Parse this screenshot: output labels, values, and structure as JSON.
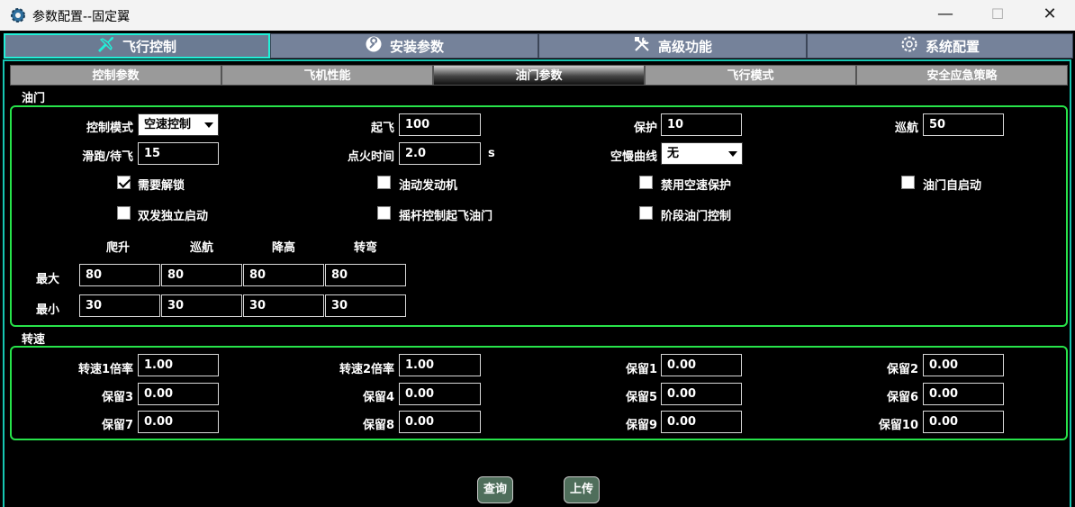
{
  "window": {
    "title": "参数配置--固定翼",
    "minimize": "—",
    "maximize": "☐",
    "close": "✕"
  },
  "main_tabs": [
    {
      "label": "飞行控制",
      "icon": "airplane-icon",
      "active": true
    },
    {
      "label": "安装参数",
      "icon": "wrench-circle-icon",
      "active": false
    },
    {
      "label": "高级功能",
      "icon": "tools-icon",
      "active": false
    },
    {
      "label": "系统配置",
      "icon": "gear-icon",
      "active": false
    }
  ],
  "sub_tabs": [
    {
      "label": "控制参数",
      "active": false
    },
    {
      "label": "飞机性能",
      "active": false
    },
    {
      "label": "油门参数",
      "active": true
    },
    {
      "label": "飞行模式",
      "active": false
    },
    {
      "label": "安全应急策略",
      "active": false
    }
  ],
  "throttle": {
    "section_title": "油门",
    "control_mode": {
      "label": "控制模式",
      "value": "空速控制"
    },
    "takeoff": {
      "label": "起飞",
      "value": "100"
    },
    "protect": {
      "label": "保护",
      "value": "10"
    },
    "cruise": {
      "label": "巡航",
      "value": "50"
    },
    "taxi_standby": {
      "label": "滑跑/待飞",
      "value": "15"
    },
    "ignition_time": {
      "label": "点火时间",
      "value": "2.0",
      "unit": "s"
    },
    "idle_curve": {
      "label": "空慢曲线",
      "value": "无"
    },
    "checkboxes": [
      {
        "label": "需要解锁",
        "checked": true
      },
      {
        "label": "油动发动机",
        "checked": false
      },
      {
        "label": "禁用空速保护",
        "checked": false
      },
      {
        "label": "油门自启动",
        "checked": false
      },
      {
        "label": "双发独立启动",
        "checked": false
      },
      {
        "label": "摇杆控制起飞油门",
        "checked": false
      },
      {
        "label": "阶段油门控制",
        "checked": false
      }
    ],
    "limits": {
      "columns": [
        "爬升",
        "巡航",
        "降高",
        "转弯"
      ],
      "rows": [
        {
          "label": "最大",
          "values": [
            "80",
            "80",
            "80",
            "80"
          ]
        },
        {
          "label": "最小",
          "values": [
            "30",
            "30",
            "30",
            "30"
          ]
        }
      ]
    }
  },
  "rpm": {
    "section_title": "转速",
    "fields": [
      {
        "label": "转速1倍率",
        "value": "1.00"
      },
      {
        "label": "转速2倍率",
        "value": "1.00"
      },
      {
        "label": "保留1",
        "value": "0.00"
      },
      {
        "label": "保留2",
        "value": "0.00"
      },
      {
        "label": "保留3",
        "value": "0.00"
      },
      {
        "label": "保留4",
        "value": "0.00"
      },
      {
        "label": "保留5",
        "value": "0.00"
      },
      {
        "label": "保留6",
        "value": "0.00"
      },
      {
        "label": "保留7",
        "value": "0.00"
      },
      {
        "label": "保留8",
        "value": "0.00"
      },
      {
        "label": "保留9",
        "value": "0.00"
      },
      {
        "label": "保留10",
        "value": "0.00"
      }
    ]
  },
  "actions": {
    "query": "查询",
    "upload": "上传"
  },
  "colors": {
    "accent_tab": "#21f0d8",
    "group_border": "#27e34a",
    "button_bg": "#4f6e5b",
    "tab_bg": "#75829a"
  }
}
